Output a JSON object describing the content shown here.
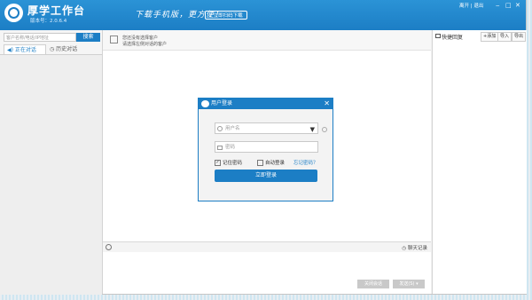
{
  "header": {
    "app_title": "厚学工作台",
    "version": "版本号：2.0.6.4",
    "slogan": "下载手机版，更方便！",
    "download_button": "立即扫码下载",
    "user_status": "离开 | 退出",
    "window_controls": [
      "‒",
      "□",
      "✕"
    ]
  },
  "sidebar": {
    "search_placeholder": "客户名称/电话/IP地址",
    "search_button": "搜索",
    "tabs": [
      {
        "label": "正在对话",
        "active": true
      },
      {
        "label": "历史对话",
        "active": false
      }
    ]
  },
  "main": {
    "info_line1": "您还没有选择客户",
    "info_line2": "请选择左侧对话的客户",
    "chat_record_label": "聊天记录",
    "close_chat_button": "关闭会话",
    "send_button": "发送(S)"
  },
  "quick_reply": {
    "title": "快捷回复",
    "buttons": [
      "+添加",
      "导入",
      "导出"
    ]
  },
  "login_dialog": {
    "title": "用户登录",
    "username_placeholder": "用户名",
    "password_placeholder": "密码",
    "remember_password": "记住密码",
    "auto_login": "自动登录",
    "forgot_password": "忘记密码？",
    "login_button": "立即登录",
    "remember_checked": true,
    "auto_login_checked": false
  },
  "colors": {
    "brand_blue": "#1c7ec5",
    "header_gradient_top": "#2b93d6",
    "background_panel": "#f2f2f2"
  }
}
